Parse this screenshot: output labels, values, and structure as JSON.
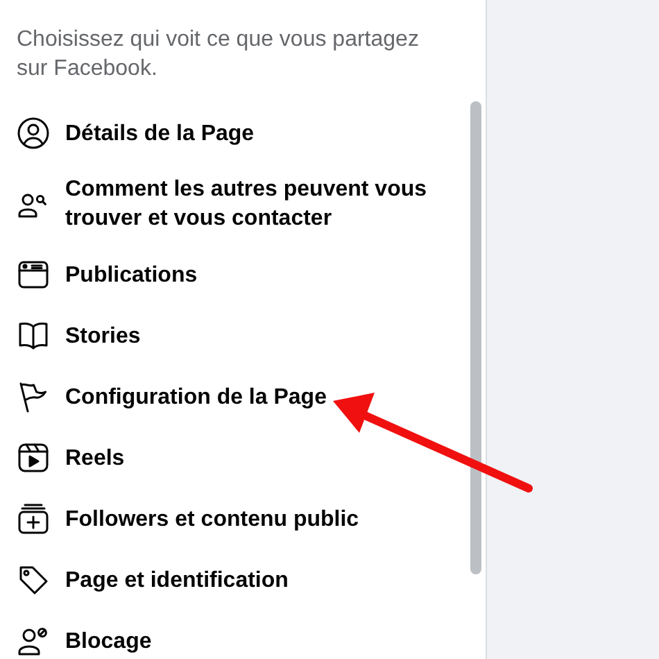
{
  "panel": {
    "subtitle": "Choisissez qui voit ce que vous partagez sur Facebook.",
    "items": [
      {
        "kind": "person-circle",
        "label": "Détails de la Page"
      },
      {
        "kind": "people-search",
        "label": "Comment les autres peuvent vous trouver et vous contacter"
      },
      {
        "kind": "card",
        "label": "Publications"
      },
      {
        "kind": "book",
        "label": "Stories"
      },
      {
        "kind": "flag",
        "label": "Configuration de la Page"
      },
      {
        "kind": "play",
        "label": "Reels"
      },
      {
        "kind": "stack-plus",
        "label": "Followers et contenu public"
      },
      {
        "kind": "tag",
        "label": "Page et identification"
      },
      {
        "kind": "person-block",
        "label": "Blocage"
      }
    ]
  },
  "annotations": [
    {
      "kind": "arrow"
    }
  ]
}
